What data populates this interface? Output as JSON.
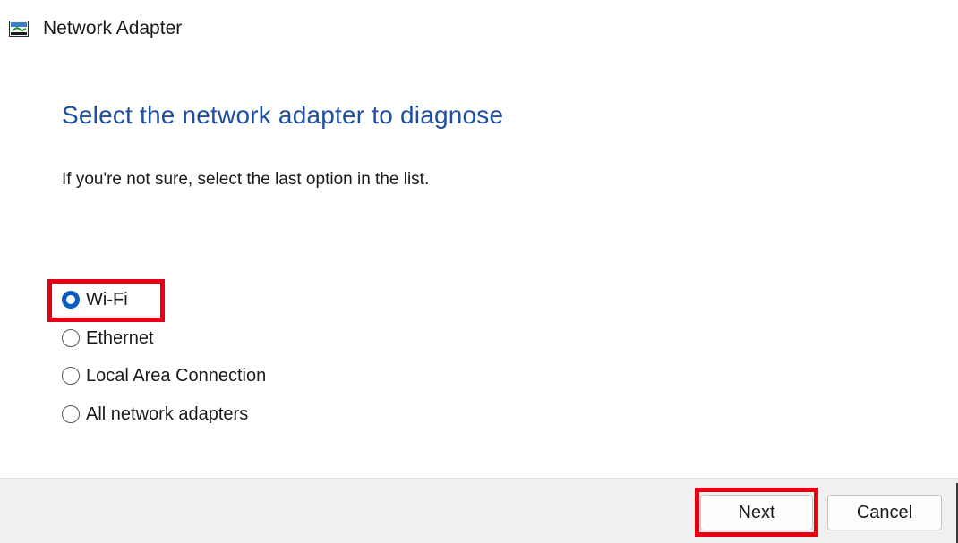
{
  "window": {
    "title": "Network Adapter",
    "icon": "network-troubleshooter-icon"
  },
  "main": {
    "heading": "Select the network adapter to diagnose",
    "subtitle": "If you're not sure, select the last option in the list.",
    "options": [
      {
        "label": "Wi-Fi",
        "selected": true
      },
      {
        "label": "Ethernet",
        "selected": false
      },
      {
        "label": "Local Area Connection",
        "selected": false
      },
      {
        "label": "All network adapters",
        "selected": false
      }
    ]
  },
  "footer": {
    "next_label": "Next",
    "cancel_label": "Cancel"
  },
  "colors": {
    "heading": "#1f4fa0",
    "radio_selected": "#0a5ac2",
    "highlight": "#e60012",
    "footer_bg": "#f0f0f0"
  }
}
